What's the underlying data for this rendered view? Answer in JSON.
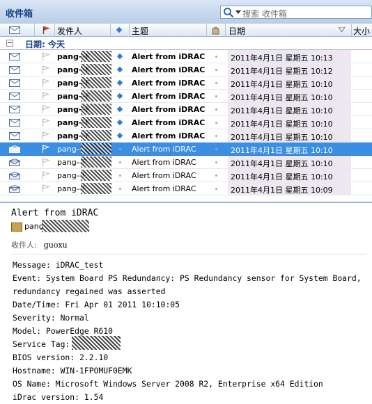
{
  "folder": {
    "title": "收件箱"
  },
  "search": {
    "placeholder": "搜索 收件箱"
  },
  "columns": {
    "from": "发件人",
    "subject": "主题",
    "date": "日期",
    "size": "大小"
  },
  "group": {
    "label": "日期: 今天"
  },
  "messages": [
    {
      "from": "pang--F",
      "subject": "Alert from iDRAC",
      "date": "2011年4月1日 星期五 10:13",
      "unread": true
    },
    {
      "from": "pang--F",
      "subject": "Alert from iDRAC",
      "date": "2011年4月1日 星期五 10:12",
      "unread": true
    },
    {
      "from": "pang--F",
      "subject": "Alert from iDRAC",
      "date": "2011年4月1日 星期五 10:10",
      "unread": true
    },
    {
      "from": "pang--F",
      "subject": "Alert from iDRAC",
      "date": "2011年4月1日 星期五 10:10",
      "unread": true
    },
    {
      "from": "pang--F",
      "subject": "Alert from iDRAC",
      "date": "2011年4月1日 星期五 10:10",
      "unread": true
    },
    {
      "from": "pang--F",
      "subject": "Alert from iDRAC",
      "date": "2011年4月1日 星期五 10:10",
      "unread": true
    },
    {
      "from": "pang--F",
      "subject": "Alert from iDRAC",
      "date": "2011年4月1日 星期五 10:10",
      "unread": true
    },
    {
      "from": "pang--F",
      "subject": "Alert from iDRAC",
      "date": "2011年4月1日 星期五 10:10",
      "unread": false,
      "selected": true
    },
    {
      "from": "pang--F",
      "subject": "Alert from iDRAC",
      "date": "2011年4月1日 星期五 10:10",
      "unread": false
    },
    {
      "from": "pang--F",
      "subject": "Alert from iDRAC",
      "date": "2011年4月1日 星期五 10:10",
      "unread": false
    },
    {
      "from": "pang--F",
      "subject": "Alert from iDRAC",
      "date": "2011年4月1日 星期五 10:09",
      "unread": false
    }
  ],
  "preview": {
    "subject": "Alert from iDRAC",
    "from": "pang",
    "to_label": "收件人:",
    "to_value": "guoxu",
    "body_lines": [
      "Message: iDRAC_test",
      "Event: System Board PS Redundancy: PS Redundancy sensor for System Board,",
      "redundancy regained was asserted",
      "Date/Time: Fri Apr 01 2011 10:10:05",
      "Severity: Normal",
      "Model: PowerEdge R610",
      "Service Tag:",
      "BIOS version: 2.2.10",
      "Hostname: WIN-1FPOMUF0EMK",
      "OS Name: Microsoft Windows Server 2008 R2, Enterprise x64 Edition",
      "iDrac version: 1.54"
    ]
  },
  "icons": {
    "search": "magnifier-icon",
    "envelope": "envelope-icon",
    "flag": "flag-icon",
    "importance": "diamond-icon",
    "attachment": "attachment-icon"
  }
}
